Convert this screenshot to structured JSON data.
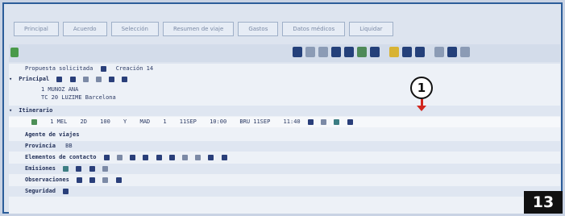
{
  "tabs": [
    "Principal",
    "Acuerdo",
    "Selección",
    "Resumen de viaje",
    "Gastos",
    "Datos médicos",
    "Liquidar"
  ],
  "header": {
    "left_label": "Propuesta solicitada",
    "right_label": "Creación 14"
  },
  "sections": {
    "principal": {
      "label": "Principal",
      "lines": [
        "1 MUNOZ ANA",
        "TC 20 LUZIME Barcelona"
      ]
    },
    "itinerario": {
      "label": "Itinerario",
      "detail": {
        "num": "1 MEL",
        "code": "2D",
        "flight": "100",
        "cls": "Y",
        "city": "MAD",
        "seg": "1",
        "date_dep": "11SEP",
        "time_dep": "10:00",
        "route": "BRU 11SEP",
        "time_arr": "11:40"
      }
    },
    "agente": {
      "label": "Agente de viajes"
    },
    "provincia": {
      "label": "Provincia",
      "value": "BB"
    },
    "elementos_contacto": {
      "label": "Elementos de contacto"
    },
    "emisiones": {
      "label": "Emisiones"
    },
    "observaciones": {
      "label": "Observaciones"
    },
    "seguridad": {
      "label": "Seguridad"
    }
  },
  "callout": {
    "number": "1"
  },
  "badge": "13"
}
